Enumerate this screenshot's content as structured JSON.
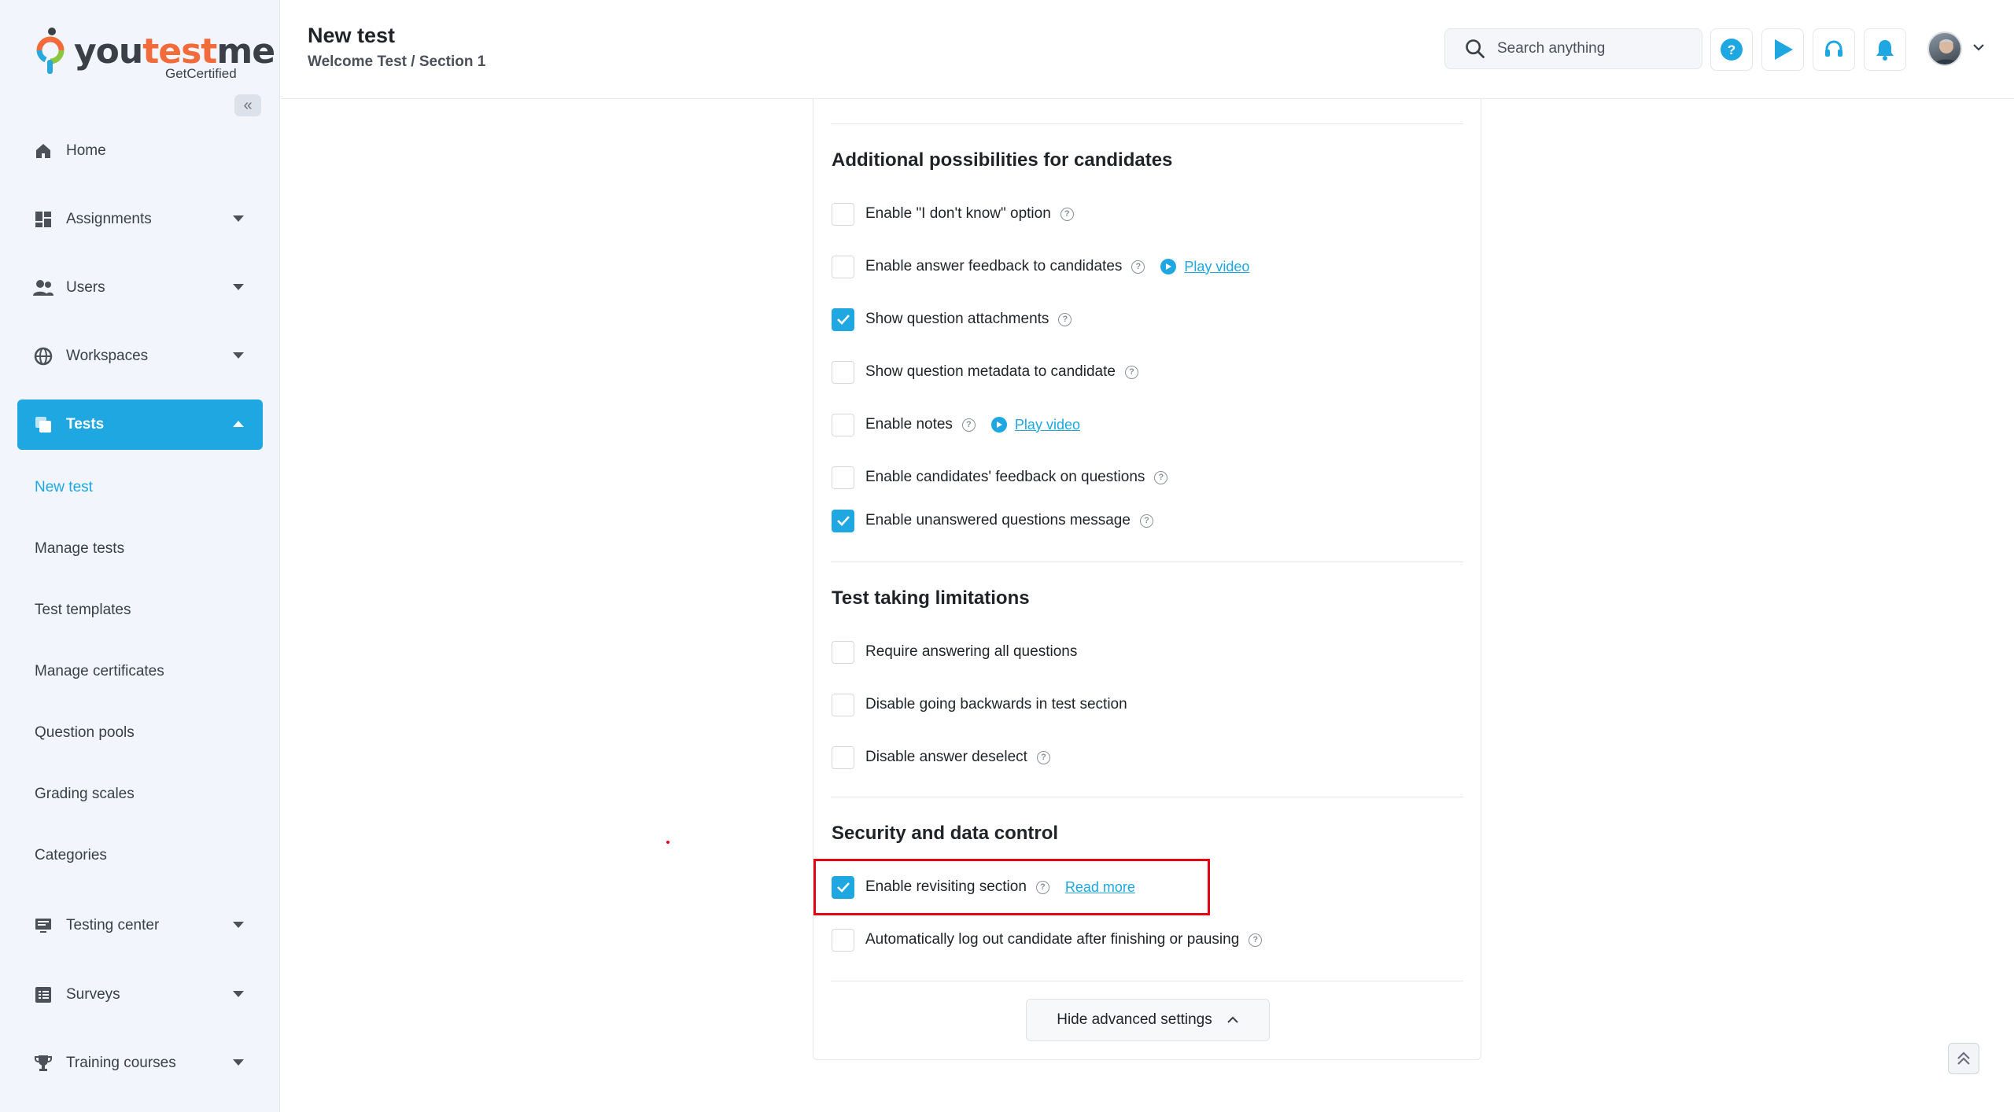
{
  "brand": {
    "name_part1": "you",
    "name_part2": "test",
    "name_part3": "me",
    "tagline": "GetCertified",
    "accent": "#1ea7e1",
    "highlight": "#e30613"
  },
  "sidebar": {
    "collapse_icon": "double-chevron-left-icon",
    "items": [
      {
        "label": "Home",
        "icon": "home-icon"
      },
      {
        "label": "Assignments",
        "icon": "dashboard-icon"
      },
      {
        "label": "Users",
        "icon": "users-icon"
      },
      {
        "label": "Workspaces",
        "icon": "globe-icon"
      },
      {
        "label": "Tests",
        "icon": "tests-icon"
      },
      {
        "label": "Testing center",
        "icon": "monitor-icon"
      },
      {
        "label": "Surveys",
        "icon": "list-icon"
      },
      {
        "label": "Training courses",
        "icon": "trophy-icon"
      }
    ],
    "sub_items": [
      {
        "label": "New test"
      },
      {
        "label": "Manage tests"
      },
      {
        "label": "Test templates"
      },
      {
        "label": "Manage certificates"
      },
      {
        "label": "Question pools"
      },
      {
        "label": "Grading scales"
      },
      {
        "label": "Categories"
      }
    ]
  },
  "header": {
    "title": "New test",
    "breadcrumb": "Welcome Test / Section 1",
    "search_placeholder": "Search anything",
    "icons": [
      "help-icon",
      "play-icon",
      "headset-icon",
      "bell-icon",
      "avatar",
      "chevron-down-icon"
    ]
  },
  "sections": {
    "additional": {
      "title": "Additional possibilities for candidates",
      "options": [
        {
          "label": "Enable \"I don't know\" option",
          "checked": false
        },
        {
          "label": "Enable answer feedback to candidates",
          "checked": false,
          "link": "Play video"
        },
        {
          "label": "Show question attachments",
          "checked": true
        },
        {
          "label": "Show question metadata to candidate",
          "checked": false
        },
        {
          "label": "Enable notes",
          "checked": false,
          "link": "Play video"
        },
        {
          "label": "Enable candidates' feedback on questions",
          "checked": false
        },
        {
          "label": "Enable unanswered questions message",
          "checked": true
        }
      ]
    },
    "limitations": {
      "title": "Test taking limitations",
      "options": [
        {
          "label": "Require answering all questions",
          "checked": false
        },
        {
          "label": "Disable going backwards in test section",
          "checked": false
        },
        {
          "label": "Disable answer deselect",
          "checked": false
        }
      ]
    },
    "security": {
      "title": "Security and data control",
      "options": [
        {
          "label": "Enable revisiting section",
          "checked": true,
          "link": "Read more"
        },
        {
          "label": "Automatically log out candidate after finishing or pausing",
          "checked": false
        }
      ]
    }
  },
  "hide_advanced_label": "Hide advanced settings"
}
